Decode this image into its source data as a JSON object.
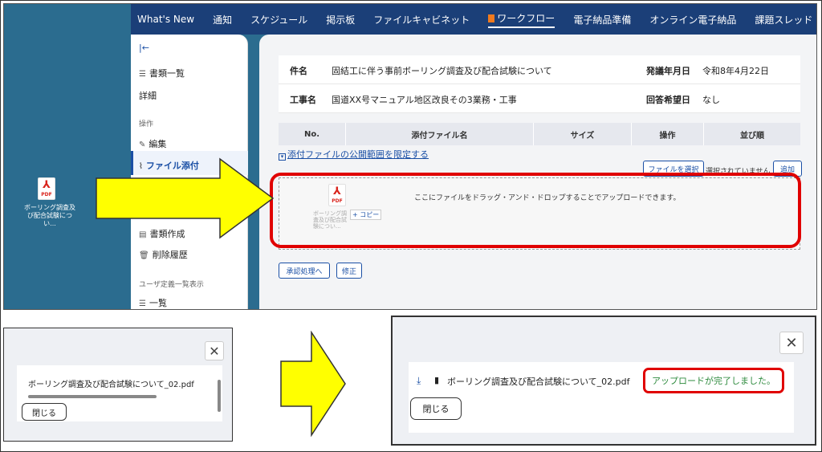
{
  "top": {
    "nav": [
      "What's New",
      "通知",
      "スケジュール",
      "掲示板",
      "ファイルキャビネット",
      "ワークフロー",
      "電子納品準備",
      "オンライン電子納品",
      "課題スレッド"
    ],
    "sidebar": {
      "collapse_icon": "|←",
      "documents_list": "書類一覧",
      "detail": "詳細",
      "operations_header": "操作",
      "edit": "編集",
      "attach_file": "ファイル添付",
      "create_document": "書類作成",
      "delete_history": "削除履歴",
      "user_view_header": "ユーザ定義一覧表示",
      "list": "一覧"
    },
    "info": {
      "subject_label": "件名",
      "subject_value": "固結工に伴う事前ボーリング調査及び配合試験について",
      "issue_date_label": "発議年月日",
      "issue_date_value": "令和8年4月22日",
      "project_label": "工事名",
      "project_value": "国道XX号マニュアル地区改良その3業務・工事",
      "reply_date_label": "回答希望日",
      "reply_date_value": "なし"
    },
    "table_headers": [
      "No.",
      "添付ファイル名",
      "サイズ",
      "操作",
      "並び順"
    ],
    "public_range_link": "添付ファイルの公開範囲を限定する",
    "choose_file_btn": "ファイルを選択",
    "not_selected": "選択されていません",
    "add_btn": "追加",
    "dropzone_text": "ここにファイルをドラッグ・アンド・ドロップすることでアップロードできます。",
    "desktop_icon_label": "ボーリング調査及び配合試験につい...",
    "drag_label": "ボーリング調査及び配合試験につい...",
    "copy_badge": "+ コピー",
    "approve_btn": "承認処理へ",
    "modify_btn": "修正",
    "pdf_label": "PDF"
  },
  "bottom_left": {
    "filename": "ボーリング調査及び配合試験について_02.pdf",
    "close_label": "閉じる"
  },
  "bottom_right": {
    "filename": "ボーリング調査及び配合試験について_02.pdf",
    "status": "アップロードが完了しました。",
    "close_label": "閉じる"
  },
  "colors": {
    "accent": "#1a4fa5",
    "highlight_red": "#e00000",
    "arrow_yellow": "#ffff00",
    "success_green": "#2e8b3e",
    "nav_bg": "#1b3f78",
    "desktop_bg": "#2b6c8f"
  }
}
